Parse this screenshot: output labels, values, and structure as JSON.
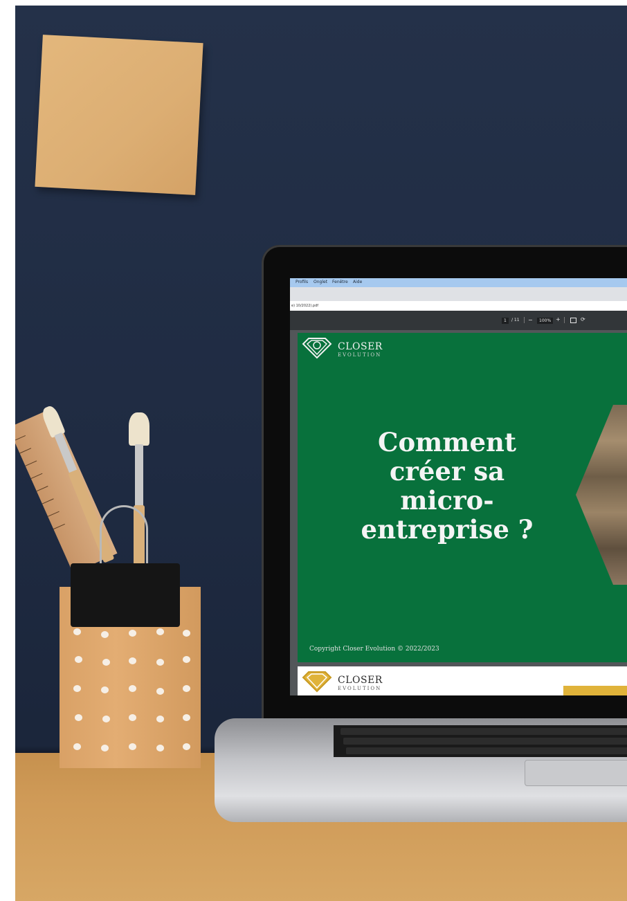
{
  "browser": {
    "menu": [
      "Profils",
      "Onglet",
      "Fenêtre",
      "Aide"
    ],
    "url": "e) 10/2022).pdf"
  },
  "pdf_toolbar": {
    "page_current": "1",
    "page_total": "/ 11",
    "zoom": "100%",
    "minus": "−",
    "plus": "+"
  },
  "slide": {
    "logo_name": "CLOSER",
    "logo_sub": "EVOLUTION",
    "title_lines": [
      "Comment",
      "créer sa",
      "micro-",
      "entreprise ?"
    ],
    "copyright": "Copyright Closer Evolution © 2022/2023"
  },
  "slide2": {
    "logo_name": "CLOSER",
    "logo_sub": "EVOLUTION"
  },
  "colors": {
    "wall": "#1f2b42",
    "slide_green": "#08713c",
    "desk": "#cf9a57",
    "sticky_note": "#dcae73"
  }
}
